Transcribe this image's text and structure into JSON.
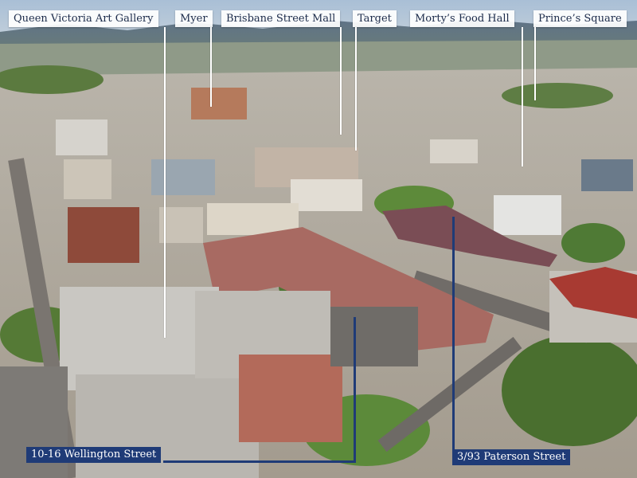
{
  "image": {
    "kind": "aerial-photograph",
    "subject": "city centre streetscape with heritage buildings, car parks and surrounding hills"
  },
  "labels": {
    "top": [
      {
        "id": "queen-victoria-art-gallery",
        "text": "Queen Victoria Art Gallery"
      },
      {
        "id": "myer",
        "text": "Myer"
      },
      {
        "id": "brisbane-street-mall",
        "text": "Brisbane Street Mall"
      },
      {
        "id": "target",
        "text": "Target"
      },
      {
        "id": "mortys-food-hall",
        "text": "Morty’s Food Hall"
      },
      {
        "id": "princes-square",
        "text": "Prince’s Square"
      }
    ],
    "bottom": [
      {
        "id": "wellington-street",
        "text": "10-16 Wellington Street"
      },
      {
        "id": "paterson-street",
        "text": "3/93 Paterson Street"
      }
    ]
  },
  "colors": {
    "label_bg": "#ffffff",
    "label_text": "#1c2b4a",
    "pointer_white": "#ffffff",
    "pointer_navy": "#1f3b77",
    "property_label_bg": "#1f3b77",
    "property_label_text": "#ffffff"
  }
}
